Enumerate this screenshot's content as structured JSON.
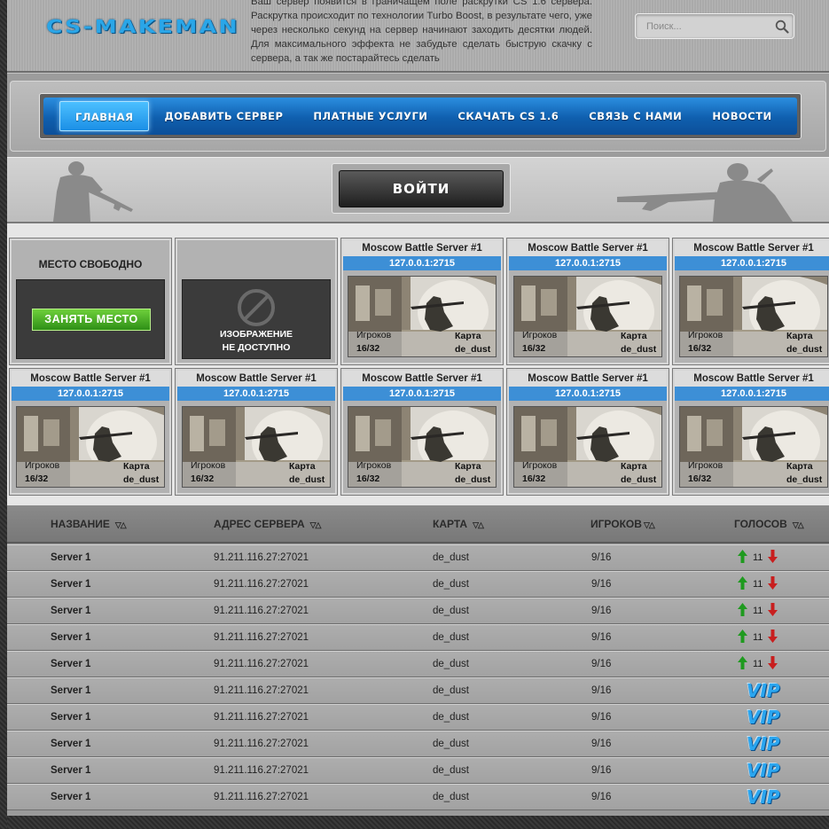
{
  "header": {
    "logo": "CS-MAKEMAN",
    "intro_text": "Ваш сервер появится в граничащем поле раскрутки CS 1.6 сервера. Раскрутка происходит по технологии Turbo Boost, в результате чего, уже через несколько секунд на сервер начинают заходить десятки людей. Для максимального эффекта не забудьте сделать быструю скачку с сервера, а так же постарайтесь сделать",
    "search": {
      "placeholder": "Поиск...",
      "icon": "search-icon"
    }
  },
  "nav": {
    "items": [
      {
        "label": "ГЛАВНАЯ"
      },
      {
        "label": "ДОБАВИТЬ СЕРВЕР"
      },
      {
        "label": "ПЛАТНЫЕ УСЛУГИ"
      },
      {
        "label": "СКАЧАТЬ CS 1.6"
      },
      {
        "label": "СВЯЗЬ С НАМИ"
      },
      {
        "label": "НОВОСТИ"
      }
    ]
  },
  "login": {
    "label": "ВОЙТИ"
  },
  "free_slot": {
    "title": "МЕСТО СВОБОДНО",
    "button": "ЗАНЯТЬ МЕСТО"
  },
  "no_image": {
    "line1": "ИЗОБРАЖЕНИЕ",
    "line2": "НЕ ДОСТУПНО"
  },
  "cards": [
    {
      "title": "Moscow Battle Server #1",
      "ip": "127.0.0.1:2715",
      "players_label": "Игроков",
      "players": "16/32",
      "map_label": "Карта",
      "map": "de_dust"
    },
    {
      "title": "Moscow Battle Server #1",
      "ip": "127.0.0.1:2715",
      "players_label": "Игроков",
      "players": "16/32",
      "map_label": "Карта",
      "map": "de_dust"
    },
    {
      "title": "Moscow Battle Server #1",
      "ip": "127.0.0.1:2715",
      "players_label": "Игроков",
      "players": "16/32",
      "map_label": "Карта",
      "map": "de_dust"
    },
    {
      "title": "Moscow Battle Server #1",
      "ip": "127.0.0.1:2715",
      "players_label": "Игроков",
      "players": "16/32",
      "map_label": "Карта",
      "map": "de_dust"
    },
    {
      "title": "Moscow Battle Server #1",
      "ip": "127.0.0.1:2715",
      "players_label": "Игроков",
      "players": "16/32",
      "map_label": "Карта",
      "map": "de_dust"
    },
    {
      "title": "Moscow Battle Server #1",
      "ip": "127.0.0.1:2715",
      "players_label": "Игроков",
      "players": "16/32",
      "map_label": "Карта",
      "map": "de_dust"
    },
    {
      "title": "Moscow Battle Server #1",
      "ip": "127.0.0.1:2715",
      "players_label": "Игроков",
      "players": "16/32",
      "map_label": "Карта",
      "map": "de_dust"
    },
    {
      "title": "Moscow Battle Server #1",
      "ip": "127.0.0.1:2715",
      "players_label": "Игроков",
      "players": "16/32",
      "map_label": "Карта",
      "map": "de_dust"
    }
  ],
  "table": {
    "headers": {
      "name": "НАЗВАНИЕ",
      "address": "АДРЕС СЕРВЕРА",
      "map": "КАРТА",
      "players": "ИГРОКОВ",
      "votes": "ГОЛОСОВ"
    },
    "sort_glyph": "▽△",
    "rows": [
      {
        "name": "Server 1",
        "address": "91.211.116.27:27021",
        "map": "de_dust",
        "players": "9/16",
        "votes": "11",
        "vip": false
      },
      {
        "name": "Server 1",
        "address": "91.211.116.27:27021",
        "map": "de_dust",
        "players": "9/16",
        "votes": "11",
        "vip": false
      },
      {
        "name": "Server 1",
        "address": "91.211.116.27:27021",
        "map": "de_dust",
        "players": "9/16",
        "votes": "11",
        "vip": false
      },
      {
        "name": "Server 1",
        "address": "91.211.116.27:27021",
        "map": "de_dust",
        "players": "9/16",
        "votes": "11",
        "vip": false
      },
      {
        "name": "Server 1",
        "address": "91.211.116.27:27021",
        "map": "de_dust",
        "players": "9/16",
        "votes": "11",
        "vip": false
      },
      {
        "name": "Server 1",
        "address": "91.211.116.27:27021",
        "map": "de_dust",
        "players": "9/16",
        "vip": true,
        "vip_label": "VIP"
      },
      {
        "name": "Server 1",
        "address": "91.211.116.27:27021",
        "map": "de_dust",
        "players": "9/16",
        "vip": true,
        "vip_label": "VIP"
      },
      {
        "name": "Server 1",
        "address": "91.211.116.27:27021",
        "map": "de_dust",
        "players": "9/16",
        "vip": true,
        "vip_label": "VIP"
      },
      {
        "name": "Server 1",
        "address": "91.211.116.27:27021",
        "map": "de_dust",
        "players": "9/16",
        "vip": true,
        "vip_label": "VIP"
      },
      {
        "name": "Server 1",
        "address": "91.211.116.27:27021",
        "map": "de_dust",
        "players": "9/16",
        "vip": true,
        "vip_label": "VIP"
      }
    ]
  },
  "colors": {
    "accent_blue": "#3d8fd6",
    "nav_blue": "#1670c4",
    "vote_up": "#1f9a1f",
    "vote_down": "#c81e1e",
    "free_button": "#4db02a"
  }
}
